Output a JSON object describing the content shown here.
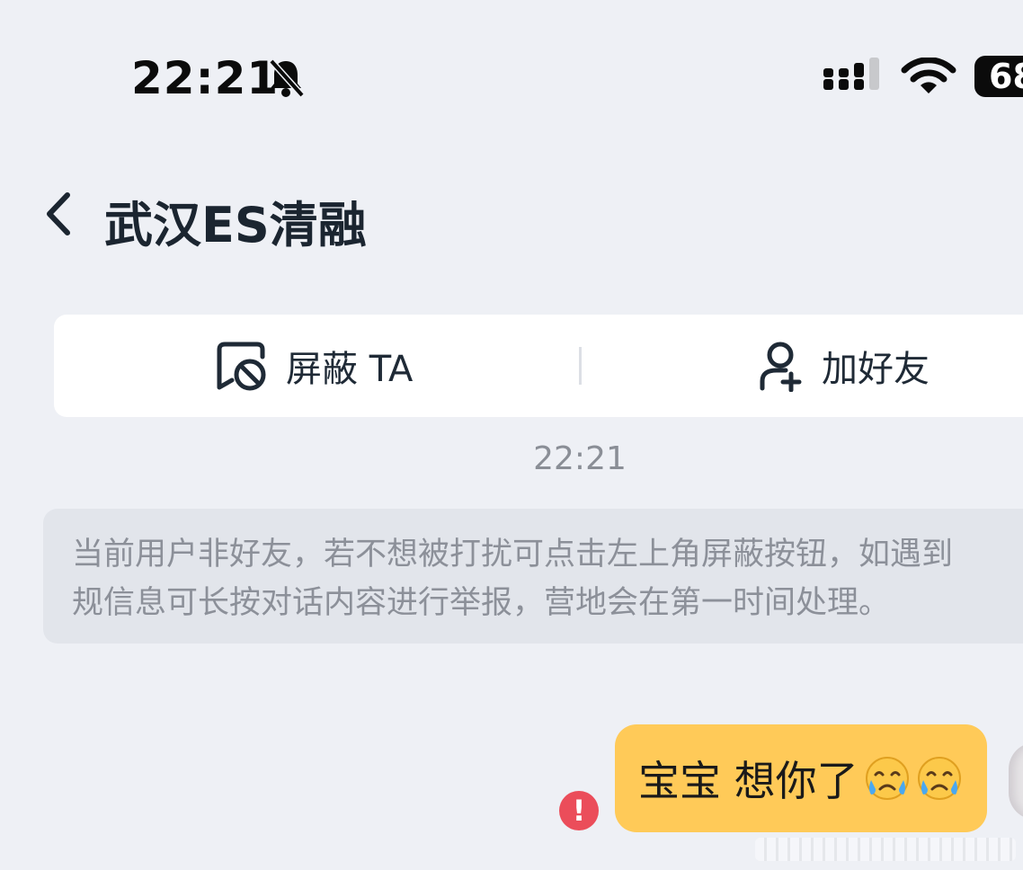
{
  "status_bar": {
    "time": "22:21",
    "battery": "68",
    "icons": [
      "bell-slash-icon",
      "signal-icon",
      "wifi-icon",
      "battery-icon"
    ]
  },
  "header": {
    "title": "武汉ES清融",
    "back_icon": "chevron-left-icon"
  },
  "actions": {
    "block": {
      "label": "屏蔽 TA",
      "icon": "block-chat-icon"
    },
    "add_friend": {
      "label": "加好友",
      "icon": "add-user-icon"
    }
  },
  "chat": {
    "timestamp": "22:21",
    "notice": {
      "line1": "当前用户非好友，若不想被打扰可点击左上角屏蔽按钮，如遇到",
      "line2": "规信息可长按对话内容进行举报，营地会在第一时间处理。"
    },
    "message": {
      "text": "宝宝 想你了",
      "emojis": [
        "crying-face-emoji",
        "crying-face-emoji"
      ],
      "status_icon": "error-icon",
      "status_symbol": "!"
    }
  },
  "colors": {
    "background": "#eef0f5",
    "bubble": "#ffca58",
    "error": "#eb4d5a",
    "notice_bg": "#e2e5eb"
  }
}
